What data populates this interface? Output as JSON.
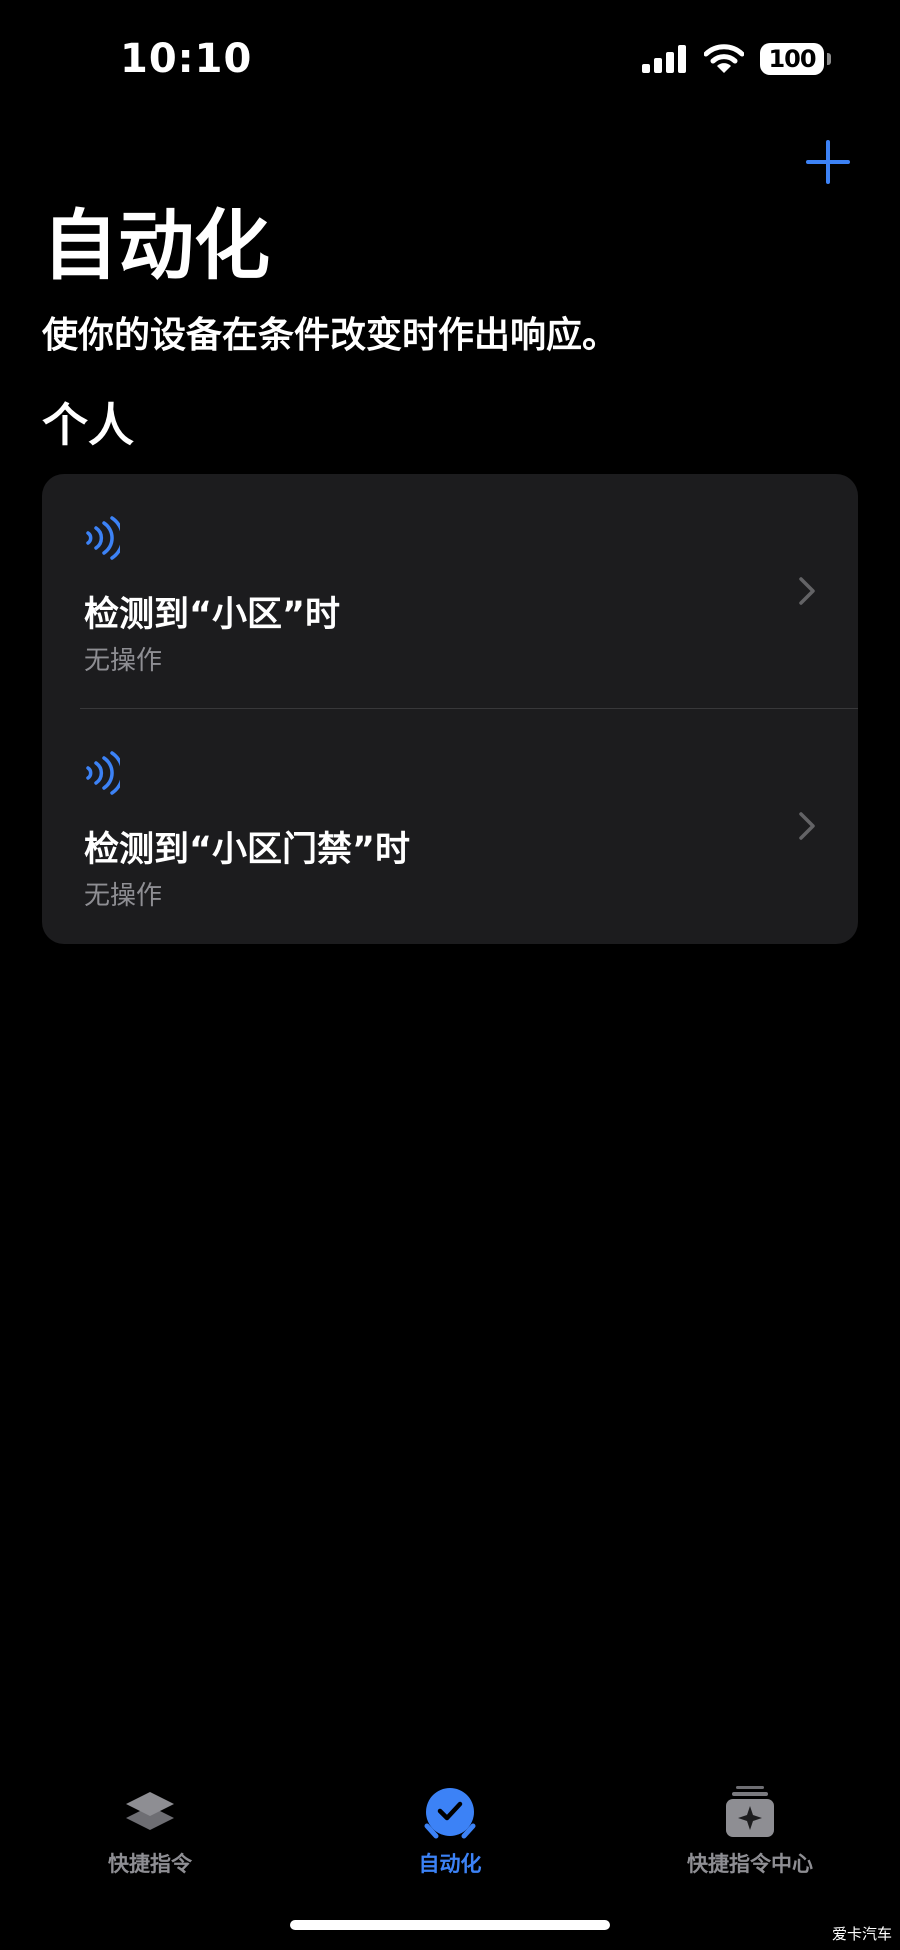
{
  "status_bar": {
    "time": "10:10",
    "battery": "100",
    "icons": [
      "cellular-signal-icon",
      "wifi-icon",
      "battery-icon"
    ]
  },
  "header": {
    "add_icon": "plus-icon",
    "title": "自动化",
    "subtitle": "使你的设备在条件改变时作出响应。"
  },
  "section": {
    "label": "个人"
  },
  "automations": [
    {
      "icon": "nfc-icon",
      "title": "检测到“小区”时",
      "subtitle": "无操作"
    },
    {
      "icon": "nfc-icon",
      "title": "检测到“小区门禁”时",
      "subtitle": "无操作"
    }
  ],
  "tab_bar": {
    "tabs": [
      {
        "label": "快捷指令",
        "icon": "layers-icon",
        "active": false
      },
      {
        "label": "自动化",
        "icon": "clock-check-icon",
        "active": true
      },
      {
        "label": "快捷指令中心",
        "icon": "gallery-sparkle-icon",
        "active": false
      }
    ]
  },
  "watermark": "爱卡汽车",
  "colors": {
    "accent": "#3c82f6",
    "background": "#000000",
    "card": "#1c1c1e",
    "secondary_text": "#8e8e93",
    "inactive_tab": "#8e8e93"
  }
}
